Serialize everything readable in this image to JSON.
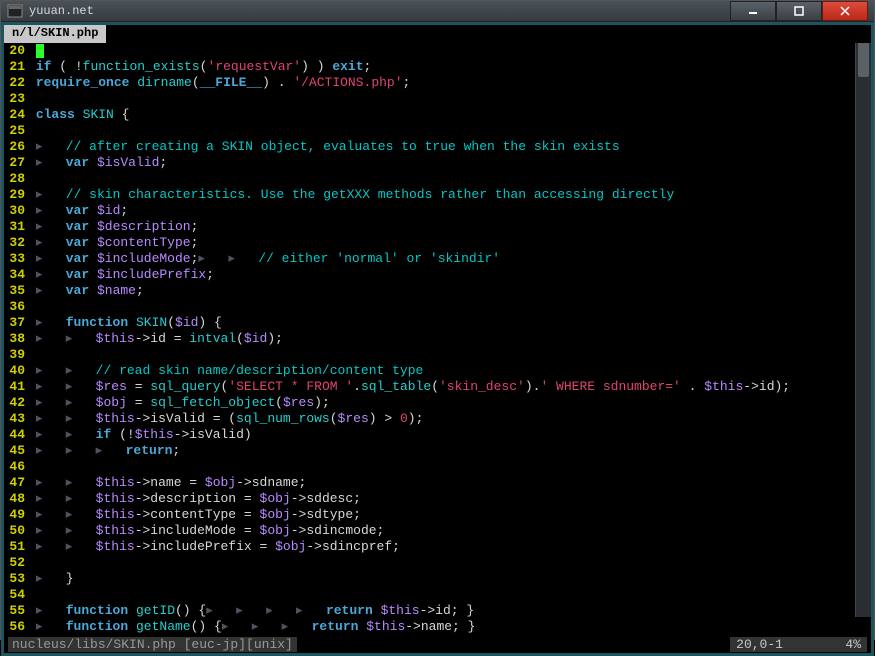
{
  "window": {
    "title": "yuuan.net"
  },
  "tab": {
    "name": "n/l/SKIN.php"
  },
  "status": {
    "left": "nucleus/libs/SKIN.php [euc-jp][unix]",
    "right_pos": "20,0-1",
    "right_pct": "4%"
  },
  "lines": [
    {
      "n": 20,
      "html": "<span class='cursor'></span>"
    },
    {
      "n": 21,
      "html": "<span class='kw'>if</span> ( !<span class='fn'>function_exists</span>(<span class='str'>'requestVar'</span>) ) <span class='kw'>exit</span>;"
    },
    {
      "n": 22,
      "html": "<span class='kw'>require_once</span> <span class='fn'>dirname</span>(<span class='kw'>__FILE__</span>) . <span class='str'>'/ACTIONS.php'</span>;"
    },
    {
      "n": 23,
      "html": ""
    },
    {
      "n": 24,
      "html": "<span class='kw'>class</span> <span class='fn'>SKIN</span> {"
    },
    {
      "n": 25,
      "html": ""
    },
    {
      "n": 26,
      "html": "<span class='tabchar'>▸   </span><span class='cmt'>// after creating a SKIN object, evaluates to true when the skin exists</span>"
    },
    {
      "n": 27,
      "html": "<span class='tabchar'>▸   </span><span class='kw'>var</span> <span class='var'>$isValid</span>;"
    },
    {
      "n": 28,
      "html": ""
    },
    {
      "n": 29,
      "html": "<span class='tabchar'>▸   </span><span class='cmt'>// skin characteristics. Use the getXXX methods rather than accessing directly</span>"
    },
    {
      "n": 30,
      "html": "<span class='tabchar'>▸   </span><span class='kw'>var</span> <span class='var'>$id</span>;"
    },
    {
      "n": 31,
      "html": "<span class='tabchar'>▸   </span><span class='kw'>var</span> <span class='var'>$description</span>;"
    },
    {
      "n": 32,
      "html": "<span class='tabchar'>▸   </span><span class='kw'>var</span> <span class='var'>$contentType</span>;"
    },
    {
      "n": 33,
      "html": "<span class='tabchar'>▸   </span><span class='kw'>var</span> <span class='var'>$includeMode</span>;<span class='tabchar'>▸   ▸   </span><span class='cmt'>// either 'normal' or 'skindir'</span>"
    },
    {
      "n": 34,
      "html": "<span class='tabchar'>▸   </span><span class='kw'>var</span> <span class='var'>$includePrefix</span>;"
    },
    {
      "n": 35,
      "html": "<span class='tabchar'>▸   </span><span class='kw'>var</span> <span class='var'>$name</span>;"
    },
    {
      "n": 36,
      "html": ""
    },
    {
      "n": 37,
      "html": "<span class='tabchar'>▸   </span><span class='kw'>function</span> <span class='fn'>SKIN</span>(<span class='var'>$id</span>) {"
    },
    {
      "n": 38,
      "html": "<span class='tabchar'>▸   ▸   </span><span class='var'>$this</span>->id = <span class='fn'>intval</span>(<span class='var'>$id</span>);"
    },
    {
      "n": 39,
      "html": ""
    },
    {
      "n": 40,
      "html": "<span class='tabchar'>▸   ▸   </span><span class='cmt'>// read skin name/description/content type</span>"
    },
    {
      "n": 41,
      "html": "<span class='tabchar'>▸   ▸   </span><span class='var'>$res</span> = <span class='fn'>sql_query</span>(<span class='str'>'SELECT * FROM '</span>.<span class='fn'>sql_table</span>(<span class='str'>'skin_desc'</span>).<span class='str'>' WHERE sdnumber='</span> . <span class='var'>$this</span>->id);"
    },
    {
      "n": 42,
      "html": "<span class='tabchar'>▸   ▸   </span><span class='var'>$obj</span> = <span class='fn'>sql_fetch_object</span>(<span class='var'>$res</span>);"
    },
    {
      "n": 43,
      "html": "<span class='tabchar'>▸   ▸   </span><span class='var'>$this</span>->isValid = (<span class='fn'>sql_num_rows</span>(<span class='var'>$res</span>) &gt; <span class='str'>0</span>);"
    },
    {
      "n": 44,
      "html": "<span class='tabchar'>▸   ▸   </span><span class='kw'>if</span> (!<span class='var'>$this</span>->isValid)"
    },
    {
      "n": 45,
      "html": "<span class='tabchar'>▸   ▸   ▸   </span><span class='kw'>return</span>;"
    },
    {
      "n": 46,
      "html": ""
    },
    {
      "n": 47,
      "html": "<span class='tabchar'>▸   ▸   </span><span class='var'>$this</span>->name = <span class='var'>$obj</span>->sdname;"
    },
    {
      "n": 48,
      "html": "<span class='tabchar'>▸   ▸   </span><span class='var'>$this</span>->description = <span class='var'>$obj</span>->sddesc;"
    },
    {
      "n": 49,
      "html": "<span class='tabchar'>▸   ▸   </span><span class='var'>$this</span>->contentType = <span class='var'>$obj</span>->sdtype;"
    },
    {
      "n": 50,
      "html": "<span class='tabchar'>▸   ▸   </span><span class='var'>$this</span>->includeMode = <span class='var'>$obj</span>->sdincmode;"
    },
    {
      "n": 51,
      "html": "<span class='tabchar'>▸   ▸   </span><span class='var'>$this</span>->includePrefix = <span class='var'>$obj</span>->sdincpref;"
    },
    {
      "n": 52,
      "html": ""
    },
    {
      "n": 53,
      "html": "<span class='tabchar'>▸   </span>}"
    },
    {
      "n": 54,
      "html": ""
    },
    {
      "n": 55,
      "html": "<span class='tabchar'>▸   </span><span class='kw'>function</span> <span class='fn'>getID</span>() {<span class='tabchar'>▸   ▸   ▸   ▸   </span><span class='kw'>return</span> <span class='var'>$this</span>->id; }"
    },
    {
      "n": 56,
      "html": "<span class='tabchar'>▸   </span><span class='kw'>function</span> <span class='fn'>getName</span>() {<span class='tabchar'>▸   ▸   ▸   </span><span class='kw'>return</span> <span class='var'>$this</span>->name; }"
    }
  ]
}
